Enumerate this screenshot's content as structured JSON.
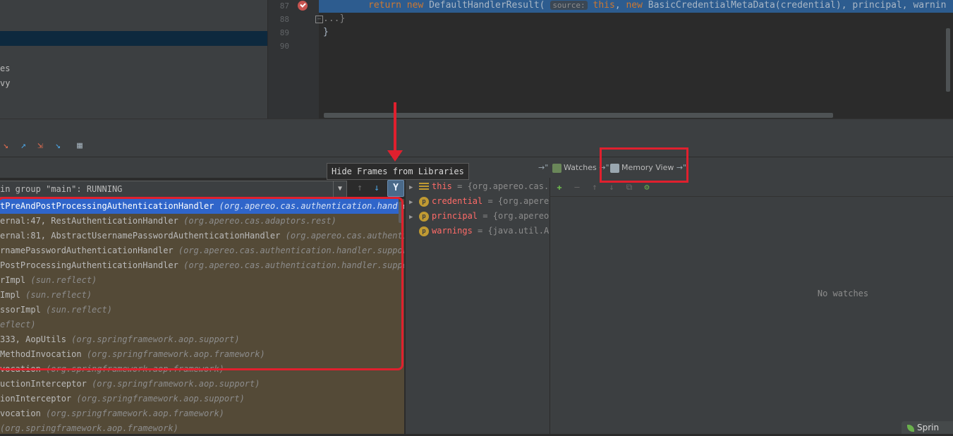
{
  "project_tree": {
    "items": [
      "es",
      "vy"
    ]
  },
  "editor": {
    "line_numbers": [
      "87",
      "88",
      "89",
      "90"
    ],
    "line87": {
      "kw_return": "return",
      "kw_new": "new",
      "call": "DefaultHandlerResult(",
      "hint": "source:",
      "kw_this": "this",
      "rest_new": "new",
      "rest": "BasicCredentialMetaData(credential), principal, warnin"
    },
    "line88": "...}",
    "line89": "}",
    "fold_glyph": "–"
  },
  "toolbar": {
    "icons": [
      "step-over-icon",
      "step-into-icon",
      "force-step-into-icon",
      "run-to-cursor-icon",
      "evaluate-icon"
    ]
  },
  "tooltip": "Hide Frames from Libraries",
  "thread_selector": {
    "value": "in group \"main\": RUNNING",
    "arrow": "▼"
  },
  "frames": [
    {
      "method": "tPreAndPostProcessingAuthenticationHandler",
      "pkg": "(org.apereo.cas.authentication.handler."
    },
    {
      "method": "ernal:47, RestAuthenticationHandler",
      "pkg": "(org.apereo.cas.adaptors.rest)"
    },
    {
      "method": "ernal:81, AbstractUsernamePasswordAuthenticationHandler",
      "pkg": "(org.apereo.cas.authentica"
    },
    {
      "method": "rnamePasswordAuthenticationHandler",
      "pkg": "(org.apereo.cas.authentication.handler.support"
    },
    {
      "method": "PostProcessingAuthenticationHandler",
      "pkg": "(org.apereo.cas.authentication.handler.support"
    },
    {
      "method": "rImpl",
      "pkg": "(sun.reflect)"
    },
    {
      "method": "Impl",
      "pkg": "(sun.reflect)"
    },
    {
      "method": "ssorImpl",
      "pkg": "(sun.reflect)"
    },
    {
      "method": "",
      "pkg": "eflect)"
    },
    {
      "method": "333, AopUtils",
      "pkg": "(org.springframework.aop.support)"
    },
    {
      "method": "MethodInvocation",
      "pkg": "(org.springframework.aop.framework)"
    },
    {
      "method": "vocation",
      "pkg": "(org.springframework.aop.framework)"
    },
    {
      "method": "uctionInterceptor",
      "pkg": "(org.springframework.aop.support)"
    },
    {
      "method": "ionInterceptor",
      "pkg": "(org.springframework.aop.support)"
    },
    {
      "method": "vocation",
      "pkg": "(org.springframework.aop.framework)"
    },
    {
      "method": "",
      "pkg": "(org.springframework.aop.framework)"
    }
  ],
  "variables": [
    {
      "name": "this",
      "value": "= {org.apereo.cas.a",
      "badge": "f",
      "expandable": true
    },
    {
      "name": "credential",
      "value": "= {org.apereo",
      "badge": "p",
      "expandable": true
    },
    {
      "name": "principal",
      "value": "= {org.apereo",
      "badge": "p",
      "expandable": true
    },
    {
      "name": "warnings",
      "value": "= {java.util.Ar",
      "badge": "p",
      "expandable": false
    }
  ],
  "tabs": {
    "pin_left": "→\"",
    "watches": "Watches",
    "watches_pin": "→\"",
    "memory_view": "Memory View",
    "memory_pin": "→\""
  },
  "watches": {
    "empty_text": "No watches"
  },
  "status_bar": {
    "spring": "Sprin"
  },
  "colors": {
    "annotation_red": "#e0202e",
    "frames_background": "#544a37",
    "selection_blue": "#2f65ca"
  }
}
